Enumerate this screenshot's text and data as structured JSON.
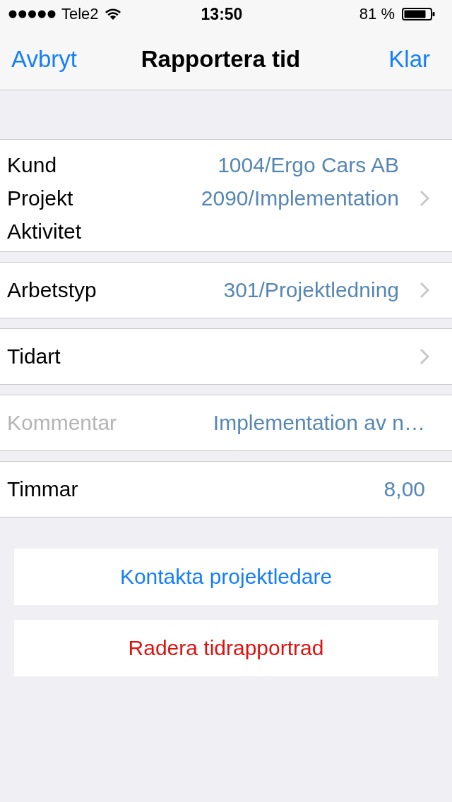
{
  "status_bar": {
    "carrier": "Tele2",
    "time": "13:50",
    "battery": "81 %"
  },
  "nav_bar": {
    "cancel": "Avbryt",
    "title": "Rapportera tid",
    "done": "Klar"
  },
  "groups": [
    {
      "disclosure": true,
      "rows": [
        {
          "label": "Kund",
          "value": "1004/Ergo Cars AB",
          "disabled": false
        },
        {
          "label": "Projekt",
          "value": "2090/Implementation",
          "disabled": false
        },
        {
          "label": "Aktivitet",
          "disabled": false
        }
      ]
    },
    {
      "disclosure": true,
      "rows": [
        {
          "label": "Arbetstyp",
          "value": "301/Projektledning",
          "disabled": false
        }
      ]
    },
    {
      "disclosure": true,
      "rows": [
        {
          "label": "Tidart",
          "disabled": false
        }
      ]
    },
    {
      "disclosure": false,
      "rows": [
        {
          "label": "Kommentar",
          "value": "Implementation av n…",
          "disabled": true
        }
      ]
    },
    {
      "disclosure": false,
      "rows": [
        {
          "label": "Timmar",
          "value": "8,00",
          "disabled": false
        }
      ]
    }
  ],
  "buttons": [
    {
      "label": "Kontakta projektledare",
      "kind": "default"
    },
    {
      "label": "Radera tidrapportrad",
      "kind": "destructive"
    }
  ]
}
